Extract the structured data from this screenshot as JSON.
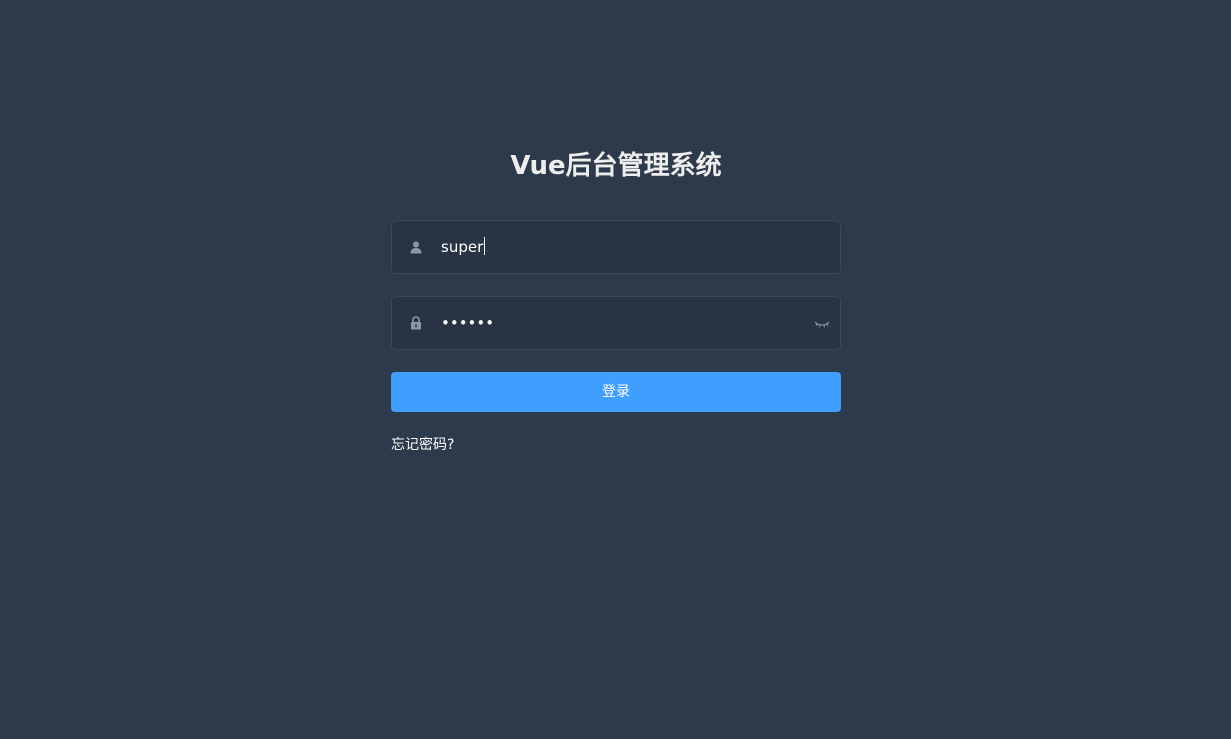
{
  "login": {
    "title": "Vue后台管理系统",
    "username": {
      "value": "super",
      "icon": "user-icon"
    },
    "password": {
      "value": "••••••",
      "icon": "lock-icon",
      "toggle_icon": "eye-closed-icon"
    },
    "login_button_label": "登录",
    "forgot_password_label": "忘记密码?"
  },
  "colors": {
    "background": "#2d3a4b",
    "input_background": "#283443",
    "primary": "#409eff",
    "icon": "#889aa4"
  }
}
